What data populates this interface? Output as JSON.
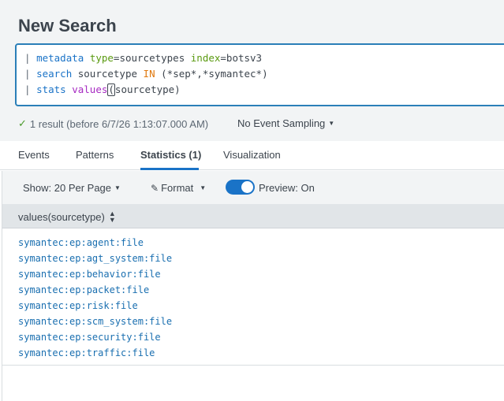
{
  "page": {
    "title": "New Search"
  },
  "query": {
    "line1": {
      "pipe": "|",
      "cmd": "metadata",
      "arg1": "type",
      "val1": "=sourcetypes",
      "arg2": "index",
      "val2": "=botsv3"
    },
    "line2": {
      "pipe": "|",
      "cmd": "search",
      "text1": "sourcetype",
      "op": "IN",
      "text2": "(*sep*,*symantec*)"
    },
    "line3": {
      "pipe": "|",
      "cmd": "stats",
      "fn": "values",
      "open_paren": "(",
      "text": "sourcetype)"
    }
  },
  "status": {
    "check_icon": "check-icon",
    "result_text": "1 result (before 6/7/26 1:13:07.000 AM)",
    "sampling_label": "No Event Sampling"
  },
  "tabs": [
    {
      "label": "Events"
    },
    {
      "label": "Patterns"
    },
    {
      "label": "Statistics (1)",
      "active": true
    },
    {
      "label": "Visualization"
    }
  ],
  "toolbar": {
    "show_label": "Show: 20 Per Page",
    "format_label": "Format",
    "preview_label": "Preview: On",
    "preview_on": true
  },
  "table": {
    "column_header": "values(sourcetype)",
    "values": [
      "symantec:ep:agent:file",
      "symantec:ep:agt_system:file",
      "symantec:ep:behavior:file",
      "symantec:ep:packet:file",
      "symantec:ep:risk:file",
      "symantec:ep:scm_system:file",
      "symantec:ep:security:file",
      "symantec:ep:traffic:file"
    ]
  },
  "colors": {
    "accent": "#1a73c7",
    "link": "#1a6fb0",
    "success": "#4a9a2a"
  }
}
